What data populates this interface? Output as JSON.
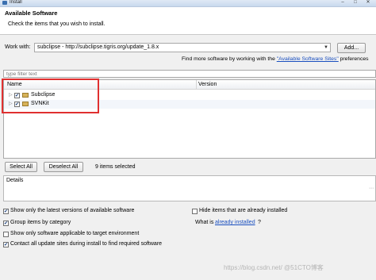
{
  "window": {
    "title": "Install"
  },
  "header": {
    "title": "Available Software",
    "description": "Check the items that you wish to install."
  },
  "work_with": {
    "label": "Work with:",
    "value": "subclipse - http://subclipse.tigris.org/update_1.8.x",
    "add_label": "Add..."
  },
  "find_more": {
    "prefix": "Find more software by working with the ",
    "link": "\"Available Software Sites\"",
    "suffix": " preferences"
  },
  "filter": {
    "placeholder": "type filter text"
  },
  "tree": {
    "columns": [
      "Name",
      "Version"
    ],
    "rows": [
      {
        "label": "Subclipse",
        "checked": true,
        "expander": "▷"
      },
      {
        "label": "SVNKit",
        "checked": true,
        "expander": "▷"
      }
    ]
  },
  "selection": {
    "select_all": "Select All",
    "deselect_all": "Deselect All",
    "count_text": "9 items selected"
  },
  "details": {
    "label": "Details"
  },
  "options": {
    "latest_versions": {
      "label": "Show only the latest versions of available software",
      "checked": true
    },
    "group_category": {
      "label": "Group items by category",
      "checked": true
    },
    "target_env": {
      "label": "Show only software applicable to target environment",
      "checked": false
    },
    "contact_sites": {
      "label": "Contact all update sites during install to find required software",
      "checked": true
    },
    "hide_installed": {
      "label": "Hide items that are already installed",
      "checked": false
    },
    "what_is": {
      "prefix": "What is ",
      "link": "already installed",
      "suffix": "?"
    }
  },
  "watermark": "https://blog.csdn.net/ @51CTO博客"
}
